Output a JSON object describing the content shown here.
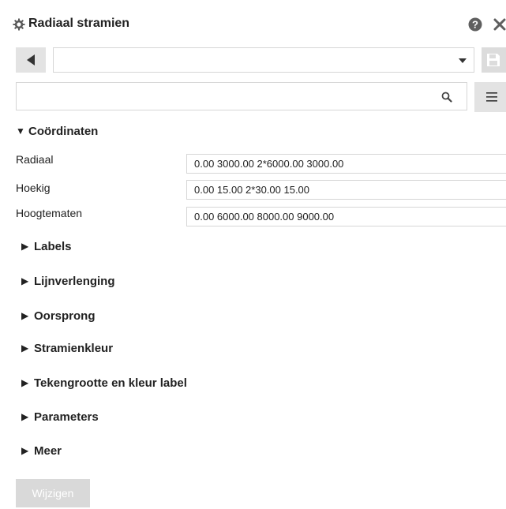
{
  "panel": {
    "title": "Radiaal stramien",
    "title_icon": "gear-icon",
    "help_icon": "help-icon",
    "close_icon": "close-icon"
  },
  "toolbar": {
    "back_icon": "triangle-left-icon",
    "preset_value": "",
    "save_icon": "save-icon"
  },
  "search": {
    "value": "",
    "placeholder": "",
    "icon": "search-icon",
    "menu_icon": "hamburger-menu-icon"
  },
  "sections": {
    "coordinates": {
      "label": "Coördinaten",
      "expanded": true,
      "rows": [
        {
          "label": "Radiaal",
          "value": "0.00 3000.00 2*6000.00 3000.00"
        },
        {
          "label": "Hoekig",
          "value": "0.00 15.00 2*30.00 15.00"
        },
        {
          "label": "Hoogtematen",
          "value": "0.00 6000.00 8000.00 9000.00"
        }
      ]
    },
    "collapsed": [
      {
        "label": "Labels"
      },
      {
        "label": "Lijnverlenging"
      },
      {
        "label": "Oorsprong"
      },
      {
        "label": "Stramienkleur"
      },
      {
        "label": "Tekengrootte en kleur label"
      },
      {
        "label": "Parameters"
      },
      {
        "label": "Meer"
      }
    ]
  },
  "apply_button": {
    "label": "Wijzigen",
    "enabled": false
  },
  "colors": {
    "button_gray": "#e3e3e3",
    "disabled_button": "#d9d9d9",
    "border": "#d6d6d6",
    "text": "#222222"
  }
}
